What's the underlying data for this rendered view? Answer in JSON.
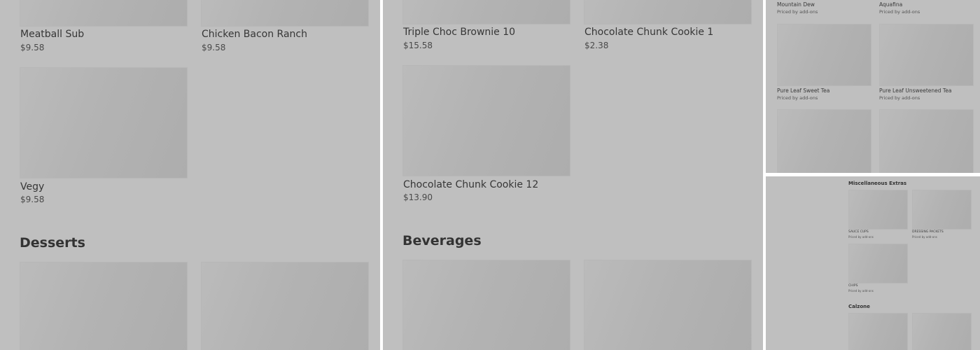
{
  "panel_1": {
    "items": [
      {
        "name": "Meatball Sub",
        "price": "$9.58"
      },
      {
        "name": "Chicken Bacon Ranch",
        "price": "$9.58"
      },
      {
        "name": "Vegy",
        "price": "$9.58"
      }
    ],
    "section_title": "Desserts"
  },
  "panel_2": {
    "items": [
      {
        "name": "Triple Choc Brownie 10",
        "price": "$15.58"
      },
      {
        "name": "Chocolate Chunk Cookie 1",
        "price": "$2.38"
      },
      {
        "name": "Chocolate Chunk Cookie 12",
        "price": "$13.90"
      }
    ],
    "section_title": "Beverages"
  },
  "panel_3": {
    "items": [
      {
        "name": "Mountain Dew",
        "price": "Priced by add-ons"
      },
      {
        "name": "Aquafina",
        "price": "Priced by add-ons"
      },
      {
        "name": "Pure Leaf Sweet Tea",
        "price": "Priced by add-ons"
      },
      {
        "name": "Pure Leaf Unsweetened Tea",
        "price": "Priced by add-ons"
      }
    ]
  },
  "panel_4": {
    "section_title": "Miscellaneous Extras",
    "items": [
      {
        "name": "SAUCE CUPS",
        "price": "Priced by add-ons"
      },
      {
        "name": "DRESSING PACKETS",
        "price": "Priced by add-ons"
      },
      {
        "name": "CHIPS",
        "price": "Priced by add-ons"
      }
    ],
    "section_title_2": "Calzone"
  }
}
